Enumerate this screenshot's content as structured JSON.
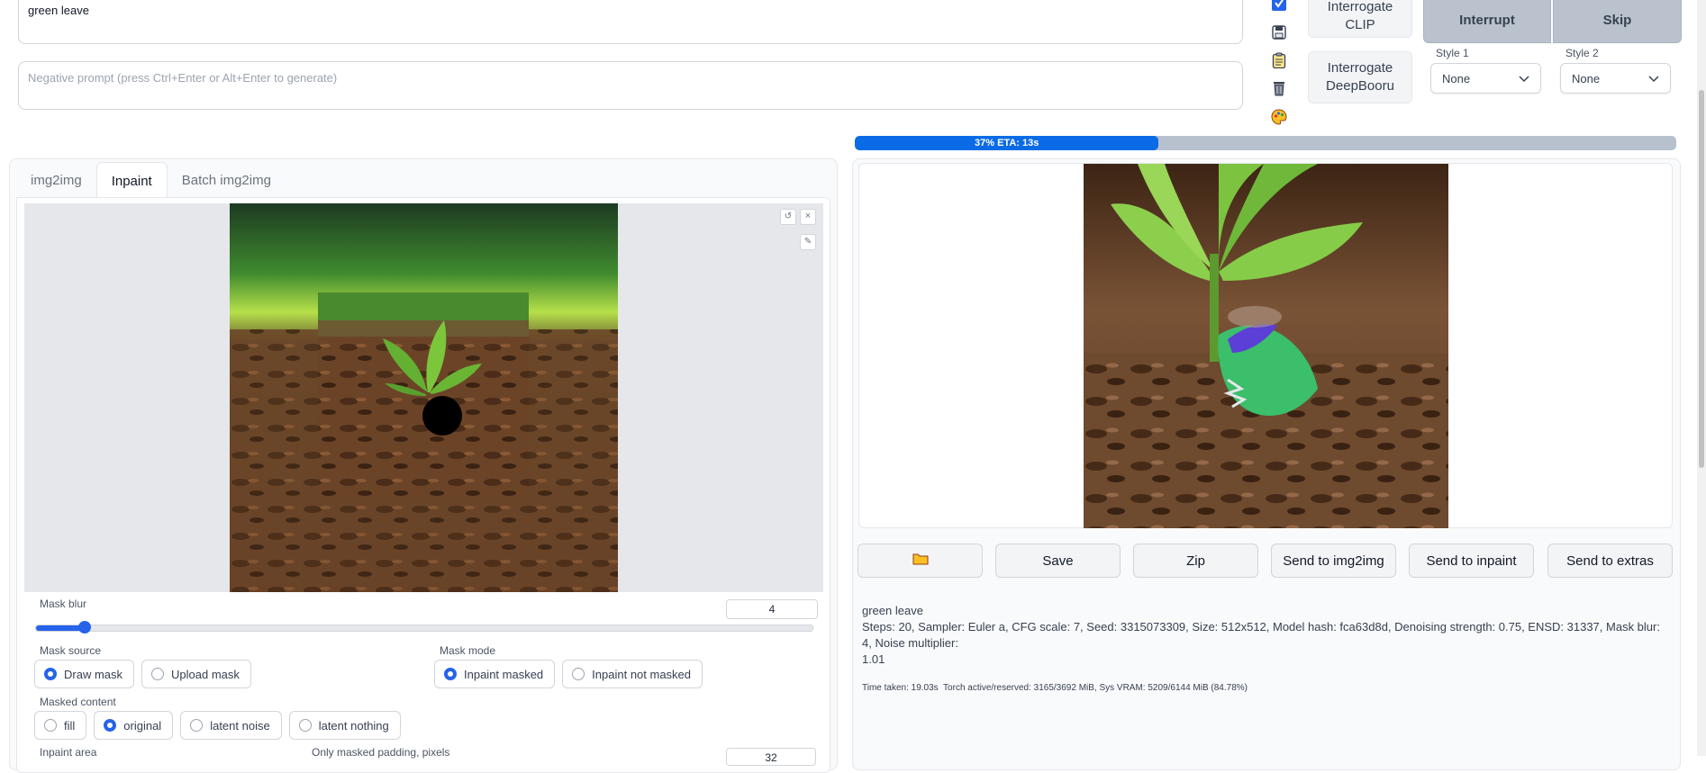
{
  "prompt": {
    "value": "green leave"
  },
  "negative_prompt": {
    "placeholder": "Negative prompt (press Ctrl+Enter or Alt+Enter to generate)"
  },
  "tool_icons": [
    "checkbox-icon",
    "save-icon",
    "clipboard-icon",
    "trash-icon",
    "palette-icon"
  ],
  "interrogate": {
    "clip_line1": "Interrogate",
    "clip_line2": "CLIP",
    "deepbooru_line1": "Interrogate",
    "deepbooru_line2": "DeepBooru"
  },
  "controls": {
    "interrupt": "Interrupt",
    "skip": "Skip"
  },
  "styles": {
    "style1": {
      "label": "Style 1",
      "value": "None"
    },
    "style2": {
      "label": "Style 2",
      "value": "None"
    }
  },
  "progress": {
    "fraction": 0.37,
    "text": "37% ETA: 13s"
  },
  "tabs": [
    "img2img",
    "Inpaint",
    "Batch img2img"
  ],
  "active_tab": "Inpaint",
  "mask_blur": {
    "label": "Mask blur",
    "value": "4",
    "min": 0,
    "max": 64
  },
  "mask_source": {
    "label": "Mask source",
    "options": [
      "Draw mask",
      "Upload mask"
    ],
    "selected": "Draw mask"
  },
  "mask_mode": {
    "label": "Mask mode",
    "options": [
      "Inpaint masked",
      "Inpaint not masked"
    ],
    "selected": "Inpaint masked"
  },
  "masked_content": {
    "label": "Masked content",
    "options": [
      "fill",
      "original",
      "latent noise",
      "latent nothing"
    ],
    "selected": "original"
  },
  "inpaint_area": {
    "label": "Inpaint area"
  },
  "padding": {
    "label": "Only masked padding, pixels",
    "value": "32"
  },
  "output_buttons": {
    "folder": "folder-icon",
    "save": "Save",
    "zip": "Zip",
    "send_img2img": "Send to img2img",
    "send_inpaint": "Send to inpaint",
    "send_extras": "Send to extras"
  },
  "generation_info": {
    "prompt": "green leave",
    "params_line1": "Steps: 20, Sampler: Euler a, CFG scale: 7, Seed: 3315073309, Size: 512x512, Model hash: fca63d8d, Denoising strength: 0.75, ENSD: 31337, Mask blur: 4, Noise multiplier:",
    "params_line2": "1.01",
    "timing": "Time taken: 19.03s  Torch active/reserved: 3165/3692 MiB, Sys VRAM: 5209/6144 MiB (84.78%)"
  },
  "colors": {
    "accent": "#2563eb",
    "progress_bg": "#b7c1cd",
    "dark_button": "#b9c2cd"
  }
}
